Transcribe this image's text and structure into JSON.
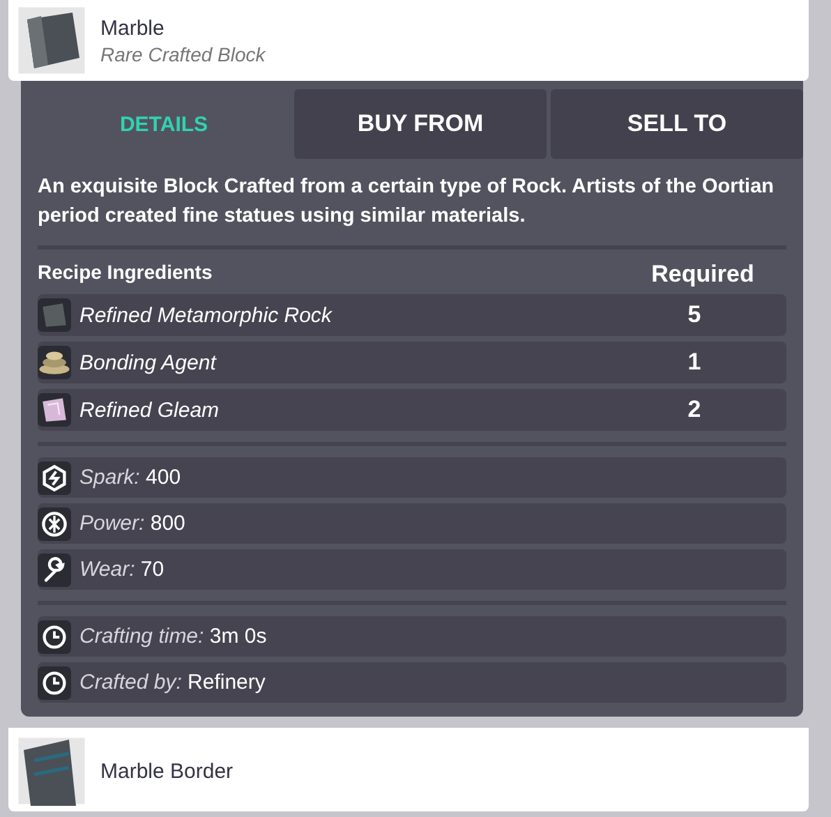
{
  "item": {
    "name": "Marble",
    "subtitle": "Rare Crafted Block"
  },
  "tabs": [
    {
      "label": "DETAILS",
      "selected": true
    },
    {
      "label": "BUY FROM",
      "selected": false
    },
    {
      "label": "SELL TO",
      "selected": false
    }
  ],
  "description": "An exquisite Block Crafted from a certain type of Rock. Artists of the Oortian period created fine statues using similar materials.",
  "ingredients": {
    "columns": [
      "Recipe Ingredients",
      "Required"
    ],
    "rows": [
      {
        "kind": "rock",
        "name": "Refined Metamorphic Rock",
        "required": "5"
      },
      {
        "kind": "bonding",
        "name": "Bonding Agent",
        "required": "1"
      },
      {
        "kind": "gleam",
        "name": "Refined Gleam",
        "required": "2"
      }
    ]
  },
  "stats": [
    {
      "kind": "spark",
      "label": "Spark:",
      "value": "400"
    },
    {
      "kind": "power",
      "label": "Power:",
      "value": "800"
    },
    {
      "kind": "wear",
      "label": "Wear:",
      "value": "70"
    }
  ],
  "crafting": [
    {
      "label": "Crafting time:",
      "value": "3m 0s"
    },
    {
      "label": "Crafted by:",
      "value": "Refinery"
    }
  ],
  "next_item": {
    "name": "Marble Border"
  }
}
